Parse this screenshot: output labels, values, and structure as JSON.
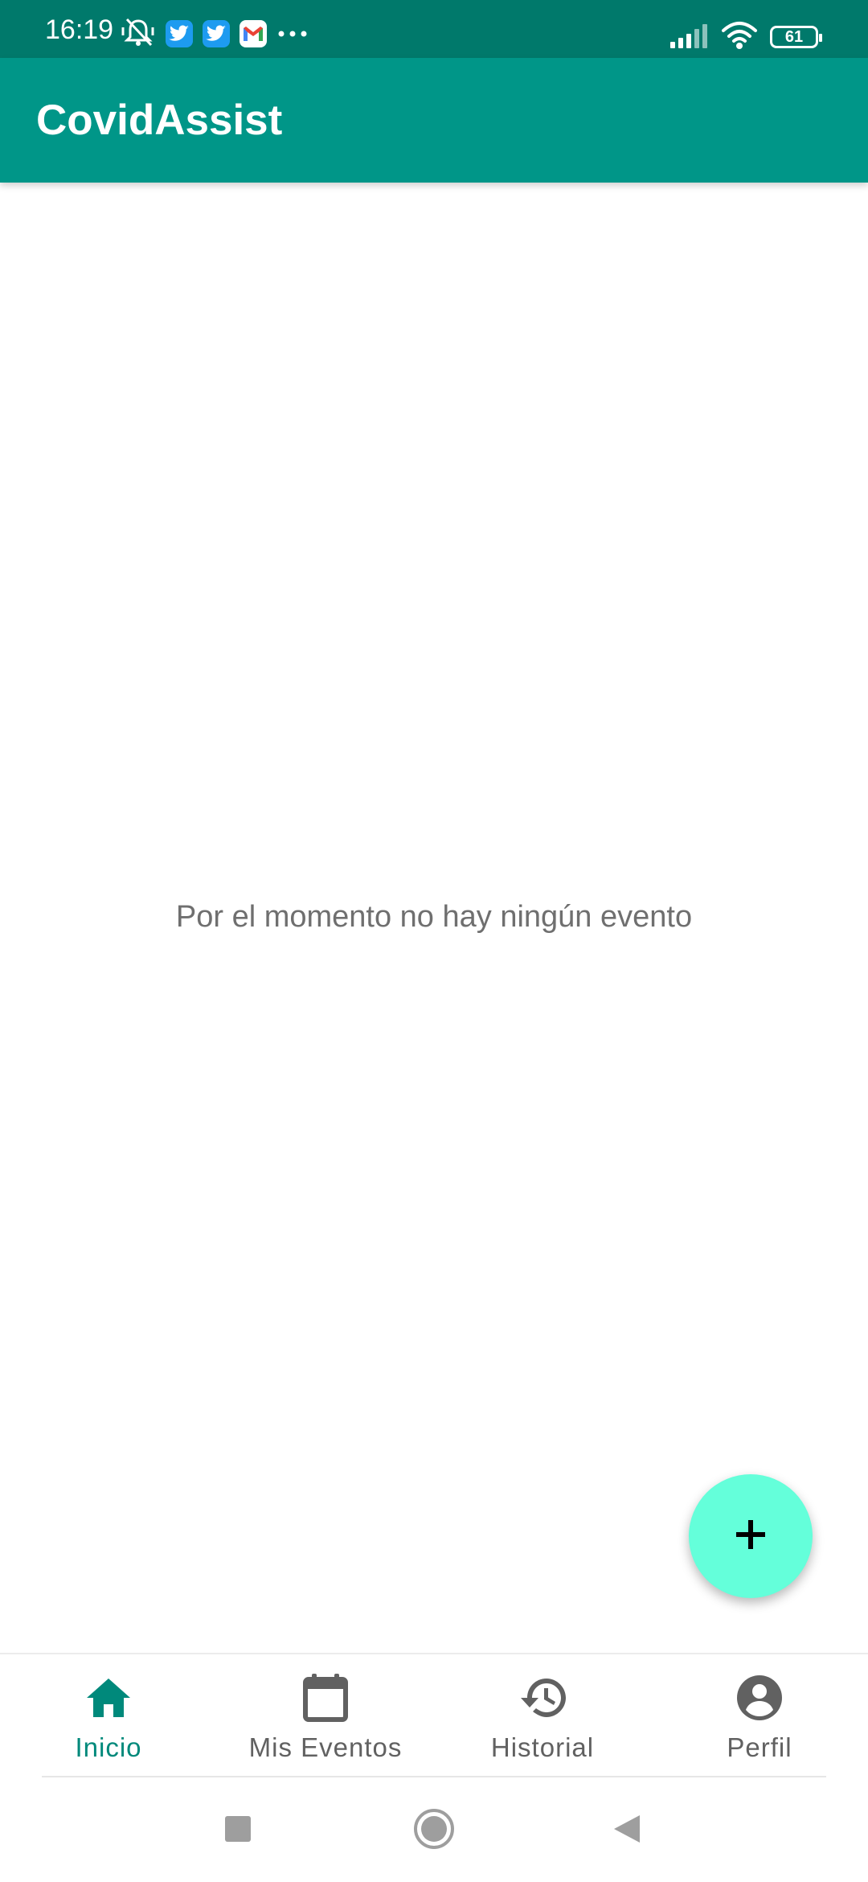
{
  "status_bar": {
    "time": "16:19",
    "battery": "61",
    "left_icons": [
      "vibrate-mute-icon",
      "twitter-icon",
      "twitter-icon",
      "gmail-icon",
      "more-dots-icon"
    ],
    "right_icons": [
      "signal-icon",
      "wifi-icon",
      "battery-icon"
    ]
  },
  "app_bar": {
    "title": "CovidAssist",
    "color": "#009688"
  },
  "main": {
    "empty_message": "Por el momento no hay ningún evento"
  },
  "fab": {
    "icon": "plus-icon",
    "color": "#64ffda"
  },
  "bottom_nav": {
    "active_color": "#00897b",
    "items": [
      {
        "label": "Inicio",
        "icon": "home-icon",
        "active": true
      },
      {
        "label": "Mis Eventos",
        "icon": "calendar-icon",
        "active": false
      },
      {
        "label": "Historial",
        "icon": "history-icon",
        "active": false
      },
      {
        "label": "Perfil",
        "icon": "account-circle-icon",
        "active": false
      }
    ]
  },
  "system_nav": {
    "icons": [
      "recents-icon",
      "home-circle-icon",
      "back-icon"
    ]
  }
}
